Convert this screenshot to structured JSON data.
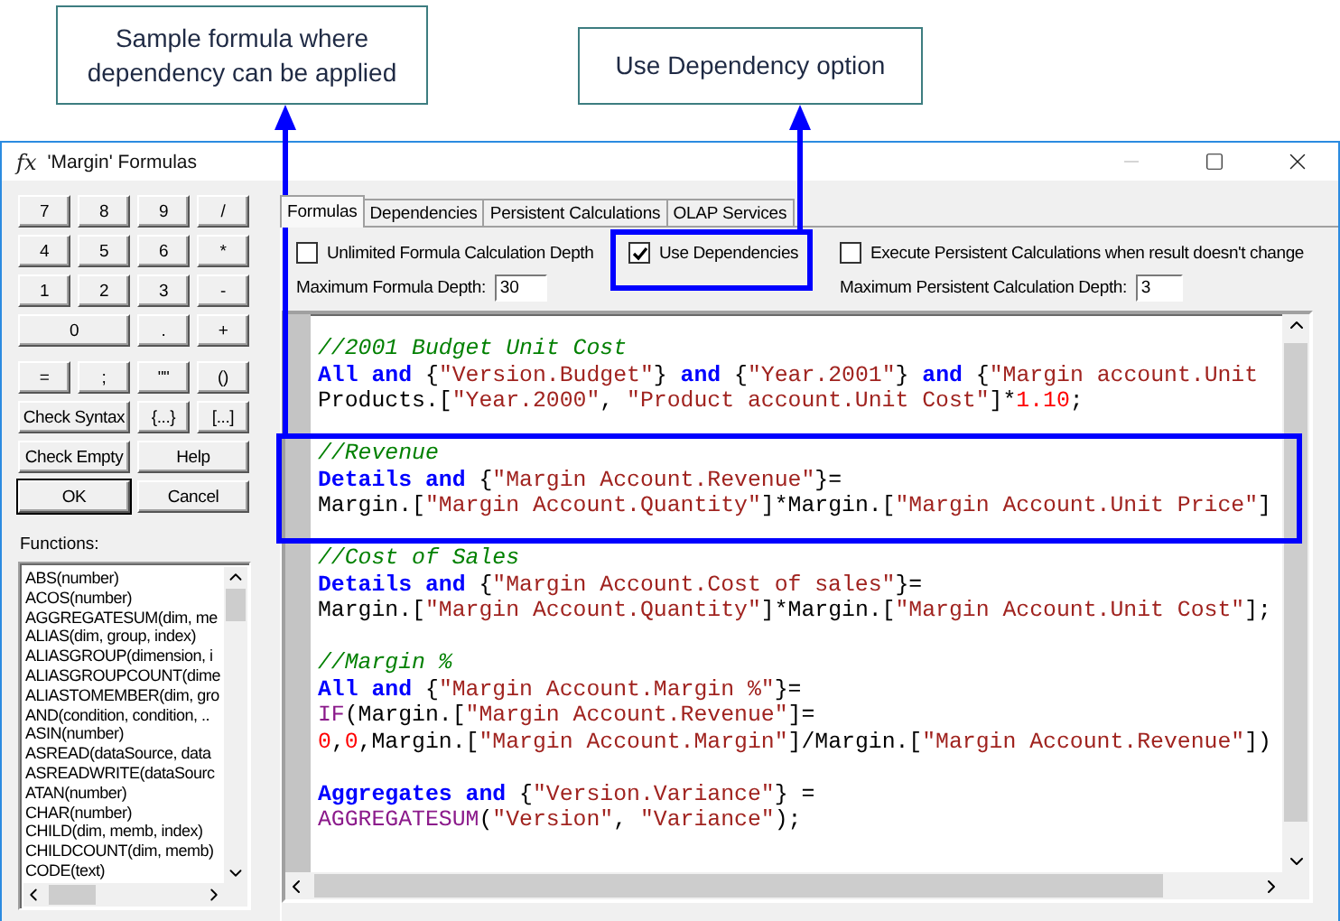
{
  "callouts": [
    {
      "text": "Sample formula where dependency can be applied"
    },
    {
      "text": "Use Dependency option"
    }
  ],
  "window": {
    "icon": "fx",
    "title": "'Margin' Formulas"
  },
  "keypad": [
    [
      [
        {
          "label": "7"
        },
        {
          "label": "8"
        },
        {
          "label": "9"
        },
        {
          "label": "/"
        }
      ],
      [
        {
          "label": "4"
        },
        {
          "label": "5"
        },
        {
          "label": "6"
        },
        {
          "label": "*"
        }
      ],
      [
        {
          "label": "1"
        },
        {
          "label": "2"
        },
        {
          "label": "3"
        },
        {
          "label": "-"
        }
      ],
      [
        {
          "label": "0"
        },
        {
          "label": "."
        },
        {
          "label": "+"
        }
      ]
    ],
    [
      [
        {
          "label": "="
        },
        {
          "label": ";"
        },
        {
          "label": "\"\""
        },
        {
          "label": "()"
        }
      ],
      [
        {
          "label": "Check Syntax"
        },
        {
          "label": "{...}"
        },
        {
          "label": "[...]"
        }
      ],
      [
        {
          "label": "Check Empty"
        },
        {
          "label": "Help"
        }
      ],
      [
        {
          "label": "OK",
          "default": true
        },
        {
          "label": "Cancel"
        }
      ]
    ]
  ],
  "functions": {
    "label": "Functions:",
    "items": [
      "ABS(number)",
      "ACOS(number)",
      "AGGREGATESUM(dim, me",
      "ALIAS(dim, group, index)",
      "ALIASGROUP(dimension, i",
      "ALIASGROUPCOUNT(dime",
      "ALIASTOMEMBER(dim, gro",
      "AND(condition, condition, ..",
      "ASIN(number)",
      "ASREAD(dataSource, data",
      "ASREADWRITE(dataSourc",
      "ATAN(number)",
      "CHAR(number)",
      "CHILD(dim, memb, index)",
      "CHILDCOUNT(dim, memb)",
      "CODE(text)"
    ]
  },
  "tabs": [
    {
      "label": "Formulas",
      "selected": true
    },
    {
      "label": "Dependencies",
      "selected": false
    },
    {
      "label": "Persistent Calculations",
      "selected": false
    },
    {
      "label": "OLAP Services",
      "selected": false
    }
  ],
  "options": {
    "checkboxes": [
      {
        "label": "Unlimited Formula Calculation Depth",
        "checked": false
      },
      {
        "label": "Use Dependencies",
        "checked": true
      },
      {
        "label": "Execute Persistent Calculations when result doesn't change",
        "checked": false
      }
    ],
    "fields": [
      {
        "label": "Maximum Formula Depth:",
        "value": "30"
      },
      {
        "label": "Maximum Persistent Calculation Depth:",
        "value": "3"
      }
    ]
  },
  "editor": {
    "blocks": [
      [
        [
          {
            "kind": "comment",
            "text": "//2001 Budget Unit Cost"
          }
        ],
        [
          {
            "kind": "keyword",
            "text": "All and"
          },
          {
            "kind": "plain",
            "text": " {"
          },
          {
            "kind": "string",
            "text": "\"Version.Budget\""
          },
          {
            "kind": "plain",
            "text": "} "
          },
          {
            "kind": "keyword",
            "text": "and"
          },
          {
            "kind": "plain",
            "text": " {"
          },
          {
            "kind": "string",
            "text": "\"Year.2001\""
          },
          {
            "kind": "plain",
            "text": "} "
          },
          {
            "kind": "keyword",
            "text": "and"
          },
          {
            "kind": "plain",
            "text": " {"
          },
          {
            "kind": "string",
            "text": "\"Margin account.Unit"
          }
        ],
        [
          {
            "kind": "plain",
            "text": "Products.["
          },
          {
            "kind": "string",
            "text": "\"Year.2000\""
          },
          {
            "kind": "plain",
            "text": ", "
          },
          {
            "kind": "string",
            "text": "\"Product account.Unit Cost\""
          },
          {
            "kind": "plain",
            "text": "]*"
          },
          {
            "kind": "number",
            "text": "1.10"
          },
          {
            "kind": "plain",
            "text": ";"
          }
        ]
      ],
      [
        [
          {
            "kind": "comment",
            "text": "//Revenue"
          }
        ],
        [
          {
            "kind": "keyword",
            "text": "Details and"
          },
          {
            "kind": "plain",
            "text": " {"
          },
          {
            "kind": "string",
            "text": "\"Margin Account.Revenue\""
          },
          {
            "kind": "plain",
            "text": "}="
          }
        ],
        [
          {
            "kind": "plain",
            "text": "Margin.["
          },
          {
            "kind": "string",
            "text": "\"Margin Account.Quantity\""
          },
          {
            "kind": "plain",
            "text": "]*Margin.["
          },
          {
            "kind": "string",
            "text": "\"Margin Account.Unit Price\""
          },
          {
            "kind": "plain",
            "text": "]"
          }
        ]
      ],
      [
        [
          {
            "kind": "comment",
            "text": "//Cost of Sales"
          }
        ],
        [
          {
            "kind": "keyword",
            "text": "Details and"
          },
          {
            "kind": "plain",
            "text": " {"
          },
          {
            "kind": "string",
            "text": "\"Margin Account.Cost of sales\""
          },
          {
            "kind": "plain",
            "text": "}="
          }
        ],
        [
          {
            "kind": "plain",
            "text": "Margin.["
          },
          {
            "kind": "string",
            "text": "\"Margin Account.Quantity\""
          },
          {
            "kind": "plain",
            "text": "]*Margin.["
          },
          {
            "kind": "string",
            "text": "\"Margin Account.Unit Cost\""
          },
          {
            "kind": "plain",
            "text": "];"
          }
        ]
      ],
      [
        [
          {
            "kind": "comment",
            "text": "//Margin %"
          }
        ],
        [
          {
            "kind": "keyword",
            "text": "All and"
          },
          {
            "kind": "plain",
            "text": " {"
          },
          {
            "kind": "string",
            "text": "\"Margin Account.Margin %\""
          },
          {
            "kind": "plain",
            "text": "}="
          }
        ],
        [
          {
            "kind": "function",
            "text": "IF"
          },
          {
            "kind": "plain",
            "text": "(Margin.["
          },
          {
            "kind": "string",
            "text": "\"Margin Account.Revenue\""
          },
          {
            "kind": "plain",
            "text": "]="
          }
        ],
        [
          {
            "kind": "number",
            "text": "0"
          },
          {
            "kind": "plain",
            "text": ","
          },
          {
            "kind": "number",
            "text": "0"
          },
          {
            "kind": "plain",
            "text": ",Margin.["
          },
          {
            "kind": "string",
            "text": "\"Margin Account.Margin\""
          },
          {
            "kind": "plain",
            "text": "]/Margin.["
          },
          {
            "kind": "string",
            "text": "\"Margin Account.Revenue\""
          },
          {
            "kind": "plain",
            "text": "])"
          }
        ]
      ],
      [
        [
          {
            "kind": "keyword",
            "text": "Aggregates and"
          },
          {
            "kind": "plain",
            "text": " {"
          },
          {
            "kind": "string",
            "text": "\"Version.Variance\""
          },
          {
            "kind": "plain",
            "text": "} ="
          }
        ],
        [
          {
            "kind": "function",
            "text": "AGGREGATESUM"
          },
          {
            "kind": "plain",
            "text": "("
          },
          {
            "kind": "string",
            "text": "\"Version\""
          },
          {
            "kind": "plain",
            "text": ", "
          },
          {
            "kind": "string",
            "text": "\"Variance\""
          },
          {
            "kind": "plain",
            "text": ");"
          }
        ]
      ]
    ]
  }
}
